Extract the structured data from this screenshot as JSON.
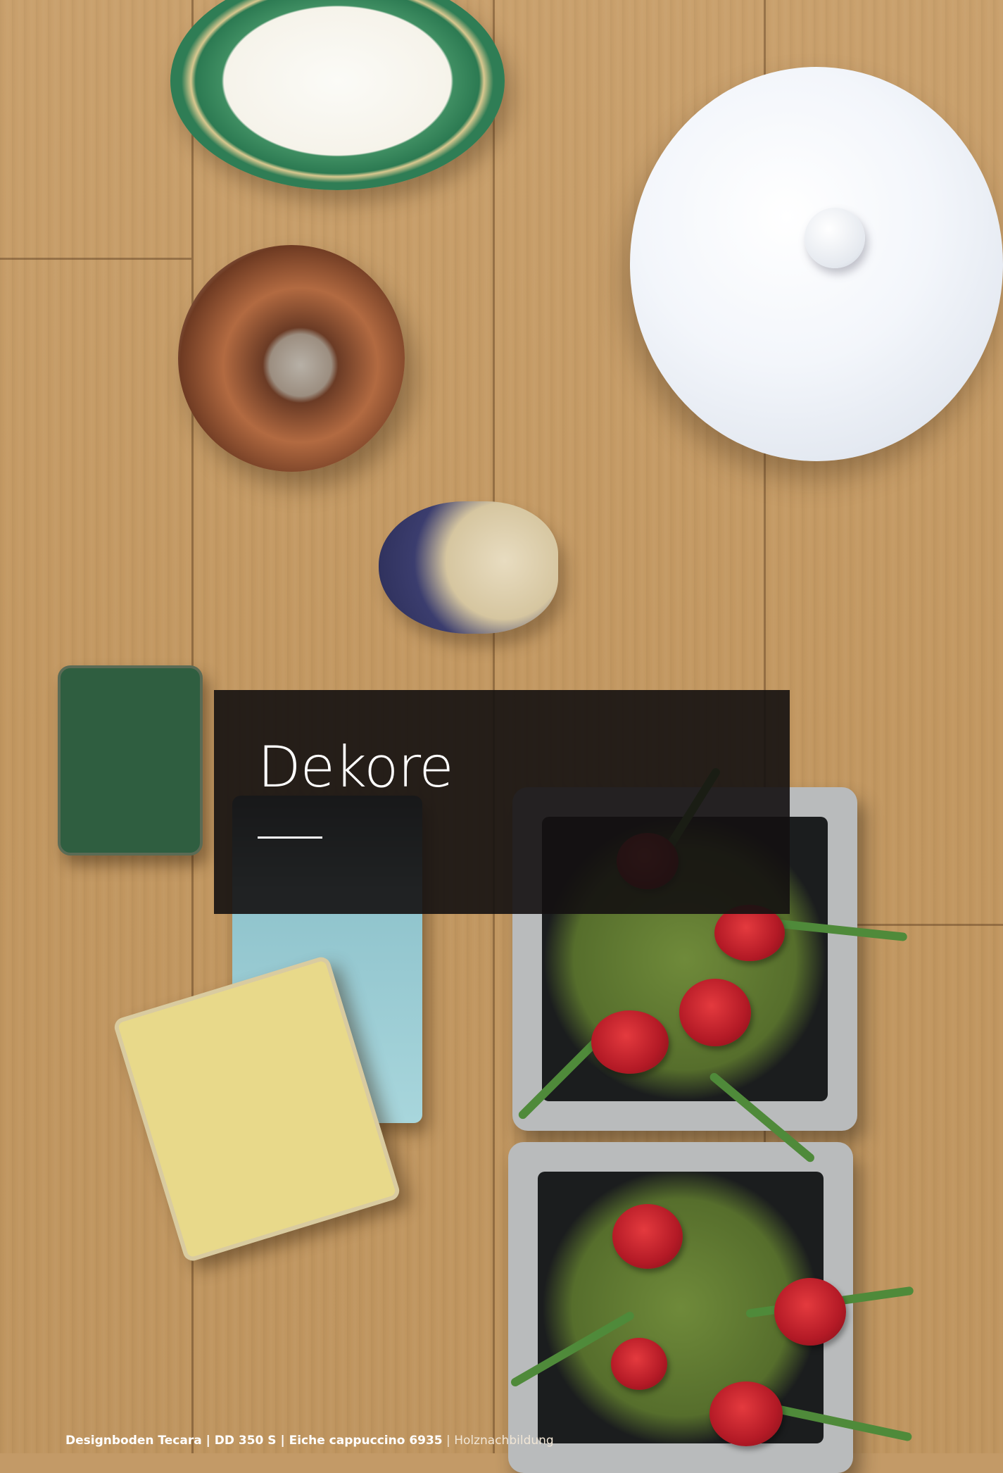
{
  "panel": {
    "title": "Dekore"
  },
  "caption": {
    "product": "Designboden Tecara | DD 350 S | Eiche cappuccino 6935",
    "separator": " | ",
    "note": "Holznachbildung"
  }
}
